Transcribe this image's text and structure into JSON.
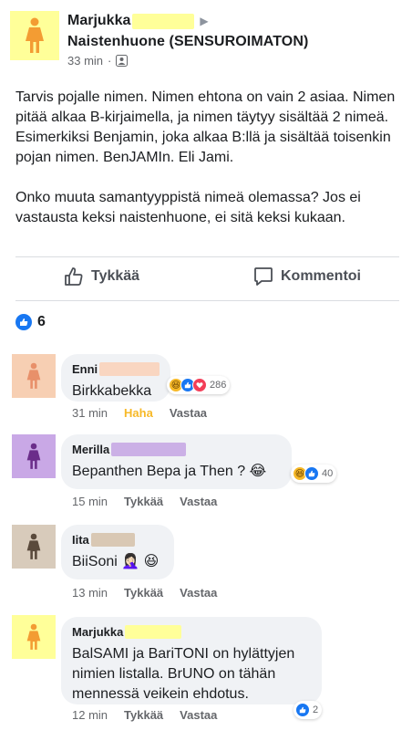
{
  "post": {
    "author": "Marjukka",
    "group": "Naistenhuone (SENSUROIMATON)",
    "time": "33 min",
    "separator": "·",
    "paragraphs": [
      "Tarvis pojalle nimen. Nimen ehtona on vain 2 asiaa. Nimen pitää alkaa B-kirjaimella, ja nimen täytyy sisältää 2 nimeä. Esimerkiksi Benjamin, joka alkaa B:llä ja sisältää toisenkin pojan nimen. BenJAMIn. Eli Jami.",
      "Onko muuta samantyyppistä nimeä olemassa? Jos ei vastausta keksi naistenhuone, ei sitä keksi kukaan."
    ],
    "colors": {
      "redact": "#ffff99"
    }
  },
  "actions": {
    "like": "Tykkää",
    "comment": "Kommentoi"
  },
  "reactions": {
    "count": "6"
  },
  "comments": [
    {
      "author": "Enni",
      "text": "Birkkabekka",
      "time": "31 min",
      "reaction_label": "Haha",
      "reply": "Vastaa",
      "reaction_count": "286",
      "avatar_color": "#f4c4a2",
      "redact_color": "#f9d6c1"
    },
    {
      "author": "Merilla",
      "text": "Bepanthen Bepa ja Then ? 😂",
      "time": "15 min",
      "like": "Tykkää",
      "reply": "Vastaa",
      "reaction_count": "40",
      "avatar_color": "#cfb0e8",
      "redact_color": "#cbb0e6"
    },
    {
      "author": "Iita",
      "text": "BiiSoni 🤦🏻‍♀️ 😆",
      "time": "13 min",
      "like": "Tykkää",
      "reply": "Vastaa",
      "avatar_color": "#ded2c4",
      "redact_color": "#d9c8b4"
    },
    {
      "author": "Marjukka",
      "text": "BalSAMI ja BariTONI on hylättyjen nimien listalla. BrUNO on tähän mennessä veikein ehdotus.",
      "time": "12 min",
      "like": "Tykkää",
      "reply": "Vastaa",
      "reaction_count": "2",
      "avatar_color": "#ffff99",
      "redact_color": "#ffff99"
    }
  ]
}
